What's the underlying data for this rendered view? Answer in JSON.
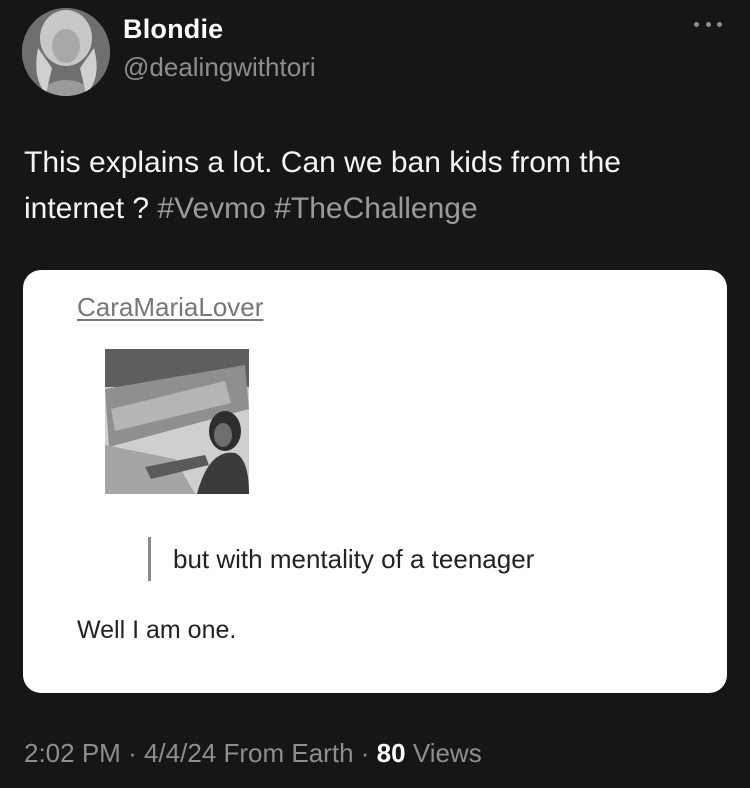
{
  "author": {
    "name": "Blondie",
    "handle": "@dealingwithtori"
  },
  "icons": {
    "more": "more-horizontal-icon"
  },
  "tweet": {
    "text_main": "This explains a lot. Can we ban kids from the internet ?",
    "hashtags": [
      "#Vevmo",
      "#TheChallenge"
    ]
  },
  "card": {
    "username": "CaraMariaLover",
    "quote": "but with mentality of a teenager",
    "reply": "Well I am one."
  },
  "meta": {
    "time": "2:02 PM",
    "date": "4/4/24",
    "source": "From Earth",
    "views_count": "80",
    "views_label": "Views",
    "separator": "·"
  }
}
